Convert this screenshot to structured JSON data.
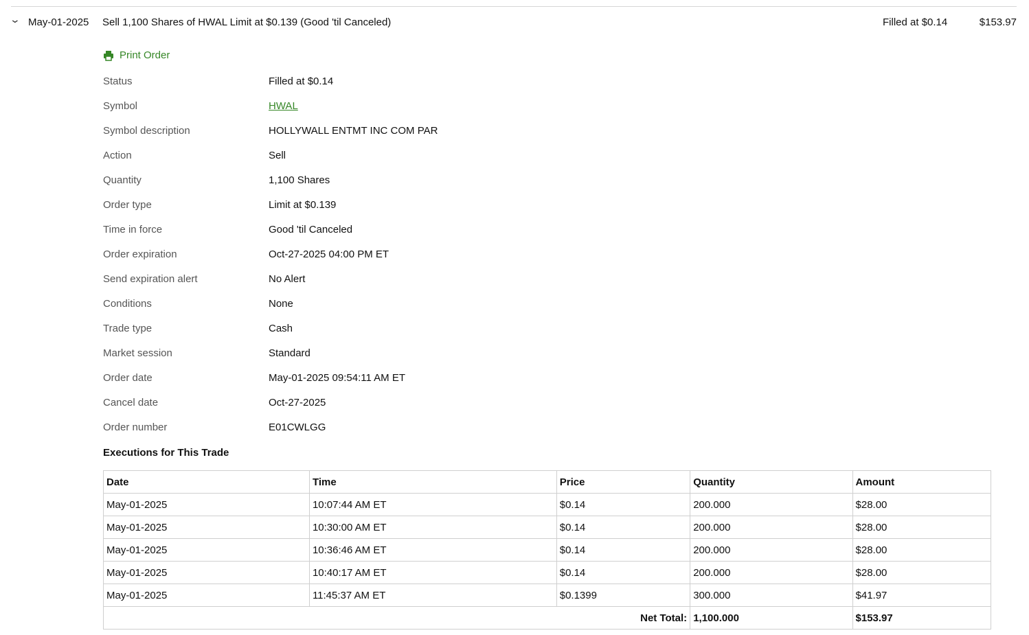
{
  "header": {
    "date": "May-01-2025",
    "description": "Sell 1,100 Shares of HWAL Limit at $0.139 (Good 'til Canceled)",
    "status": "Filled at $0.14",
    "amount": "$153.97"
  },
  "print_label": "Print Order",
  "details": [
    {
      "label": "Status",
      "value": "Filled at $0.14"
    },
    {
      "label": "Symbol",
      "value": "HWAL",
      "link": true
    },
    {
      "label": "Symbol description",
      "value": "HOLLYWALL ENTMT INC COM PAR"
    },
    {
      "label": "Action",
      "value": "Sell"
    },
    {
      "label": "Quantity",
      "value": "1,100 Shares"
    },
    {
      "label": "Order type",
      "value": "Limit at $0.139"
    },
    {
      "label": "Time in force",
      "value": "Good 'til Canceled"
    },
    {
      "label": "Order expiration",
      "value": "Oct-27-2025 04:00 PM ET"
    },
    {
      "label": "Send expiration alert",
      "value": "No Alert"
    },
    {
      "label": "Conditions",
      "value": "None"
    },
    {
      "label": "Trade type",
      "value": "Cash"
    },
    {
      "label": "Market session",
      "value": "Standard"
    },
    {
      "label": "Order date",
      "value": "May-01-2025 09:54:11 AM ET"
    },
    {
      "label": "Cancel date",
      "value": "Oct-27-2025"
    },
    {
      "label": "Order number",
      "value": "E01CWLGG"
    }
  ],
  "executions": {
    "title": "Executions for This Trade",
    "columns": [
      "Date",
      "Time",
      "Price",
      "Quantity",
      "Amount"
    ],
    "rows": [
      [
        "May-01-2025",
        "10:07:44 AM ET",
        "$0.14",
        "200.000",
        "$28.00"
      ],
      [
        "May-01-2025",
        "10:30:00 AM ET",
        "$0.14",
        "200.000",
        "$28.00"
      ],
      [
        "May-01-2025",
        "10:36:46 AM ET",
        "$0.14",
        "200.000",
        "$28.00"
      ],
      [
        "May-01-2025",
        "10:40:17 AM ET",
        "$0.14",
        "200.000",
        "$28.00"
      ],
      [
        "May-01-2025",
        "11:45:37 AM ET",
        "$0.1399",
        "300.000",
        "$41.97"
      ]
    ],
    "total_label": "Net Total:",
    "total_quantity": "1,100.000",
    "total_amount": "$153.97"
  }
}
